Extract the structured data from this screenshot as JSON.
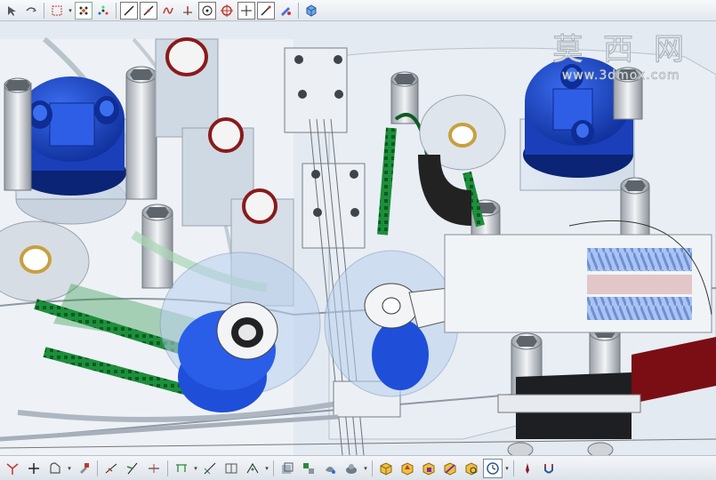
{
  "watermark": {
    "chinese": "莫 西 网",
    "url": "www.3dmox.com"
  },
  "toolbar_top": {
    "icons": [
      "select-arrow-icon",
      "pointer-icon",
      "selection-box-icon",
      "snap-points-icon",
      "snap-grid-icon",
      "line-icon",
      "diagonal-line-icon",
      "curve-icon",
      "axis-icon",
      "circle-center-icon",
      "circle-target-icon",
      "crosshair-icon",
      "pencil-icon",
      "shade-icon",
      "box-3d-icon"
    ]
  },
  "toolbar_bottom": {
    "icons": [
      "axis-triad-icon",
      "plus-icon",
      "shape-icon",
      "tool-icon",
      "constraint-icon",
      "bevel-icon",
      "trim-icon",
      "measure-icon",
      "align-icon",
      "table-icon",
      "split-icon",
      "layer-icon",
      "group-icon",
      "paint-icon",
      "material-icon",
      "cube-add-icon",
      "cube-edit-icon",
      "cube-move-icon",
      "cube-cut-icon",
      "cube-view-icon",
      "clock-icon",
      "pen-icon",
      "magnet-icon"
    ]
  },
  "colors": {
    "blue_part": "#1f4fd8",
    "green_belt": "#1c8f3a",
    "dark_red_part": "#7a0e14",
    "metal": "#c8ccd2"
  }
}
